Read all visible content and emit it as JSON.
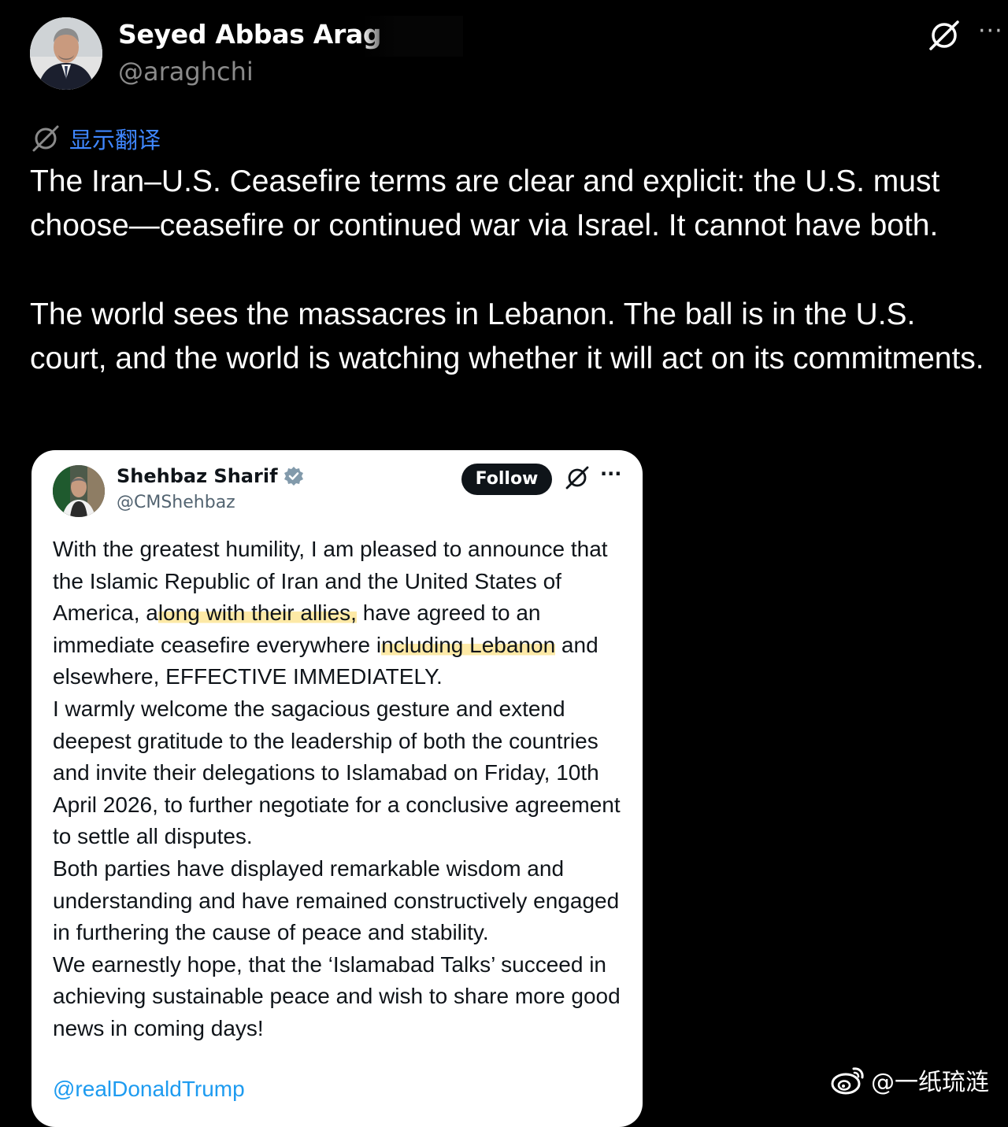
{
  "post": {
    "author_name": "Seyed Abbas Arag",
    "author_handle": "@araghchi",
    "translate_label": "显示翻译",
    "text_paragraphs": [
      "The Iran–U.S. Ceasefire terms are clear and explicit: the U.S. must choose—ceasefire or continued war via Israel. It cannot have both.",
      "The world sees the massacres in Lebanon. The ball is in the U.S. court, and the world is watching whether it will act on its commitments."
    ]
  },
  "quoted_post": {
    "author_name": "Shehbaz Sharif",
    "author_handle": "@CMShehbaz",
    "follow_label": "Follow",
    "body": {
      "p1_a": "With the greatest humility, I am pleased to announce that the Islamic Republic of Iran and the United States of America, a",
      "p1_hl1": "long with their allies,",
      "p1_b": " have agreed to an immediate ceasefire everywhere i",
      "p1_hl2": "ncluding Lebanon",
      "p1_c": " and elsewhere, EFFECTIVE IMMEDIATELY.",
      "p2": "I warmly welcome the sagacious gesture and extend deepest gratitude to the leadership of both the countries and invite their delegations to Islamabad on Friday, 10th April 2026, to further negotiate for a conclusive agreement to settle all disputes.",
      "p3": "Both parties have displayed remarkable wisdom and understanding and have remained constructively engaged in furthering the cause of peace and stability.",
      "p4": "We earnestly hope, that the ‘Islamabad Talks’ succeed in achieving sustainable peace and wish to share more good news in coming days!"
    },
    "mention": "@realDonaldTrump"
  },
  "watermark": {
    "text": "@一纸琉涟"
  },
  "icons": {
    "grok": "grok-icon",
    "more": "more-icon",
    "translate": "grok-icon",
    "verified": "verified-badge-icon",
    "weibo": "weibo-logo-icon"
  },
  "colors": {
    "background": "#000000",
    "link_blue": "#3f87ff",
    "mention_blue": "#1d9bf0",
    "highlight": "#fde9a6",
    "card_bg": "#ffffff"
  }
}
